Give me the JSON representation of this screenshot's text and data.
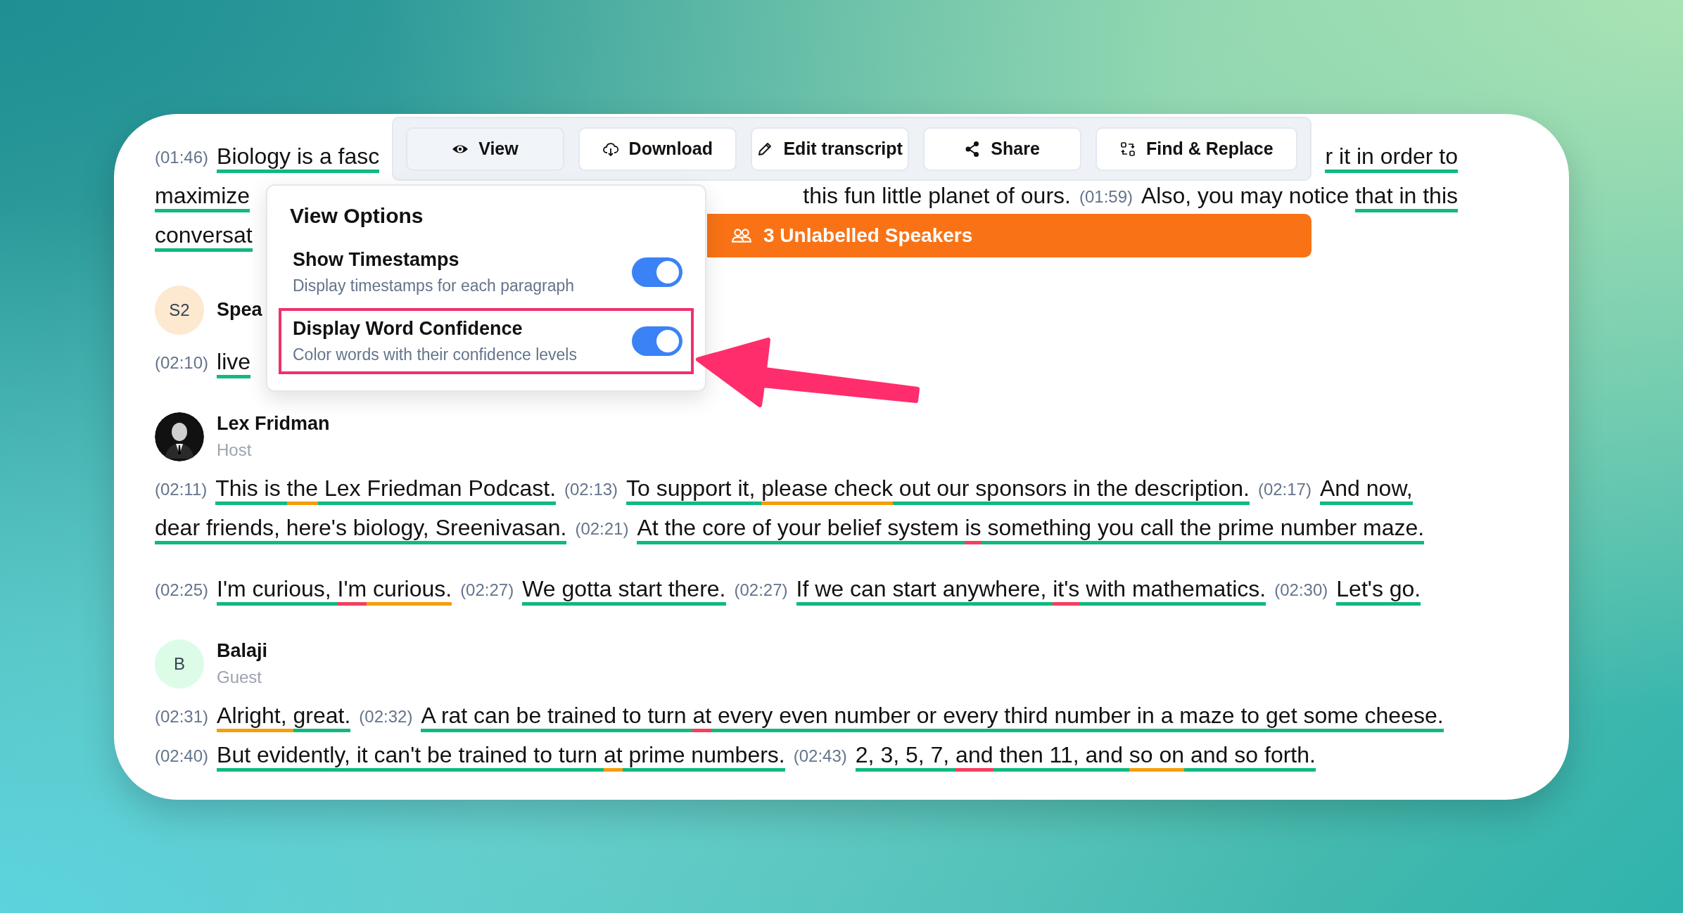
{
  "toolbar": {
    "buttons": [
      {
        "label": "View",
        "selected": true
      },
      {
        "label": "Download",
        "selected": false
      },
      {
        "label": "Edit transcript",
        "selected": false
      },
      {
        "label": "Share",
        "selected": false
      },
      {
        "label": "Find & Replace",
        "selected": false
      }
    ]
  },
  "view_options": {
    "title": "View Options",
    "options": [
      {
        "label": "Show Timestamps",
        "description": "Display timestamps for each paragraph",
        "on": true,
        "highlighted": false
      },
      {
        "label": "Display Word Confidence",
        "description": "Color words with their confidence levels",
        "on": true,
        "highlighted": true
      }
    ]
  },
  "banner": {
    "label": "3 Unlabelled Speakers"
  },
  "transcript": [
    {
      "paragraphs": [
        {
          "lines": [
            {
              "parts": [
                {
                  "kind": "timestamp",
                  "text": "(01:46)"
                },
                {
                  "kind": "words",
                  "text": "Biology is a fasc",
                  "color": "#10b981"
                }
              ],
              "trailing": [
                {
                  "kind": "words",
                  "text": "r it in order to",
                  "color": "#10b981"
                }
              ]
            },
            {
              "parts": [
                {
                  "kind": "words",
                  "text": "maximize",
                  "color": "#10b981"
                }
              ],
              "trailing": [
                {
                  "kind": "words",
                  "text": "this fun little planet of ours."
                },
                {
                  "kind": "timestamp",
                  "text": "(01:59)"
                },
                {
                  "kind": "words",
                  "text": "Also, you may notice "
                },
                {
                  "kind": "words",
                  "text": "that in this",
                  "color": "#10b981"
                }
              ]
            },
            {
              "parts": [
                {
                  "kind": "words",
                  "text": "conversat",
                  "color": "#10b981"
                }
              ]
            }
          ]
        }
      ]
    },
    {
      "speaker": {
        "name": "Spea",
        "avatar": {
          "kind": "initials",
          "text": "S2",
          "color": "#fde8d0"
        }
      },
      "paragraphs": [
        {
          "lines": [
            {
              "parts": [
                {
                  "kind": "timestamp",
                  "text": "(02:10)"
                },
                {
                  "kind": "words",
                  "text": "live",
                  "color": "#10b981"
                }
              ]
            }
          ]
        }
      ]
    },
    {
      "speaker": {
        "name": "Lex Fridman",
        "role": "Host"
      },
      "paragraphs": [
        {
          "lines": [
            {
              "parts": [
                {
                  "kind": "timestamp",
                  "text": "(02:11)"
                },
                {
                  "kind": "words",
                  "text": "This is ",
                  "color": "#10b981"
                },
                {
                  "kind": "words",
                  "text": "the",
                  "color": "#f59e0b"
                },
                {
                  "kind": "words",
                  "text": " Lex Friedman Podcast.",
                  "color": "#10b981"
                },
                {
                  "kind": "timestamp",
                  "text": "(02:13)"
                },
                {
                  "kind": "words",
                  "text": "To support it, ",
                  "color": "#10b981"
                },
                {
                  "kind": "words",
                  "text": "please check",
                  "color": "#f59e0b"
                },
                {
                  "kind": "words",
                  "text": " out our sponsors in the description.",
                  "color": "#10b981"
                },
                {
                  "kind": "timestamp",
                  "text": "(02:17)"
                },
                {
                  "kind": "words",
                  "text": "And now,",
                  "color": "#10b981"
                }
              ]
            },
            {
              "parts": [
                {
                  "kind": "words",
                  "text": "dear friends, here's biology, Sreenivasan.",
                  "color": "#10b981"
                },
                {
                  "kind": "timestamp",
                  "text": "(02:21)"
                },
                {
                  "kind": "words",
                  "text": "At the core of your belief system ",
                  "color": "#10b981"
                },
                {
                  "kind": "words",
                  "text": "is",
                  "color": "#f43f5e"
                },
                {
                  "kind": "words",
                  "text": " something you call the prime number maze.",
                  "color": "#10b981"
                }
              ]
            }
          ]
        },
        {
          "lines": [
            {
              "parts": [
                {
                  "kind": "timestamp",
                  "text": "(02:25)"
                },
                {
                  "kind": "words",
                  "text": "I'm curious, ",
                  "color": "#10b981"
                },
                {
                  "kind": "words",
                  "text": "I'm",
                  "color": "#f43f5e"
                },
                {
                  "kind": "words",
                  "text": " curious.",
                  "color": "#f59e0b"
                },
                {
                  "kind": "timestamp",
                  "text": "(02:27)"
                },
                {
                  "kind": "words",
                  "text": "We gotta start there.",
                  "color": "#10b981"
                },
                {
                  "kind": "timestamp",
                  "text": "(02:27)"
                },
                {
                  "kind": "words",
                  "text": "If we can start anywhere, ",
                  "color": "#10b981"
                },
                {
                  "kind": "words",
                  "text": "it's",
                  "color": "#f43f5e"
                },
                {
                  "kind": "words",
                  "text": " with mathematics.",
                  "color": "#10b981"
                },
                {
                  "kind": "timestamp",
                  "text": "(02:30)"
                },
                {
                  "kind": "words",
                  "text": "Let's go.",
                  "color": "#10b981"
                }
              ]
            }
          ]
        }
      ]
    },
    {
      "speaker": {
        "name": "Balaji",
        "role": "Guest",
        "avatar": {
          "kind": "initials",
          "text": "B",
          "color": "#dcfce7"
        }
      },
      "paragraphs": [
        {
          "lines": [
            {
              "parts": [
                {
                  "kind": "timestamp",
                  "text": "(02:31)"
                },
                {
                  "kind": "words",
                  "text": "Alright, ",
                  "color": "#f59e0b"
                },
                {
                  "kind": "words",
                  "text": "great.",
                  "color": "#10b981"
                },
                {
                  "kind": "timestamp",
                  "text": "(02:32)"
                },
                {
                  "kind": "words",
                  "text": "A rat can be trained to turn ",
                  "color": "#10b981"
                },
                {
                  "kind": "words",
                  "text": "at",
                  "color": "#f43f5e"
                },
                {
                  "kind": "words",
                  "text": " every even number or every third number in a maze to get some cheese.",
                  "color": "#10b981"
                }
              ]
            },
            {
              "parts": [
                {
                  "kind": "timestamp",
                  "text": "(02:40)"
                },
                {
                  "kind": "words",
                  "text": "But evidently, it can't be trained to turn ",
                  "color": "#10b981"
                },
                {
                  "kind": "words",
                  "text": "at",
                  "color": "#f59e0b"
                },
                {
                  "kind": "words",
                  "text": " prime numbers.",
                  "color": "#10b981"
                },
                {
                  "kind": "timestamp",
                  "text": "(02:43)"
                },
                {
                  "kind": "words",
                  "text": "2, 3, 5, 7, ",
                  "color": "#10b981"
                },
                {
                  "kind": "words",
                  "text": "and",
                  "color": "#f43f5e"
                },
                {
                  "kind": "words",
                  "text": " then 11, and ",
                  "color": "#10b981"
                },
                {
                  "kind": "words",
                  "text": "so on",
                  "color": "#f59e0b"
                },
                {
                  "kind": "words",
                  "text": " and so forth.",
                  "color": "#10b981"
                }
              ]
            }
          ]
        }
      ]
    }
  ]
}
